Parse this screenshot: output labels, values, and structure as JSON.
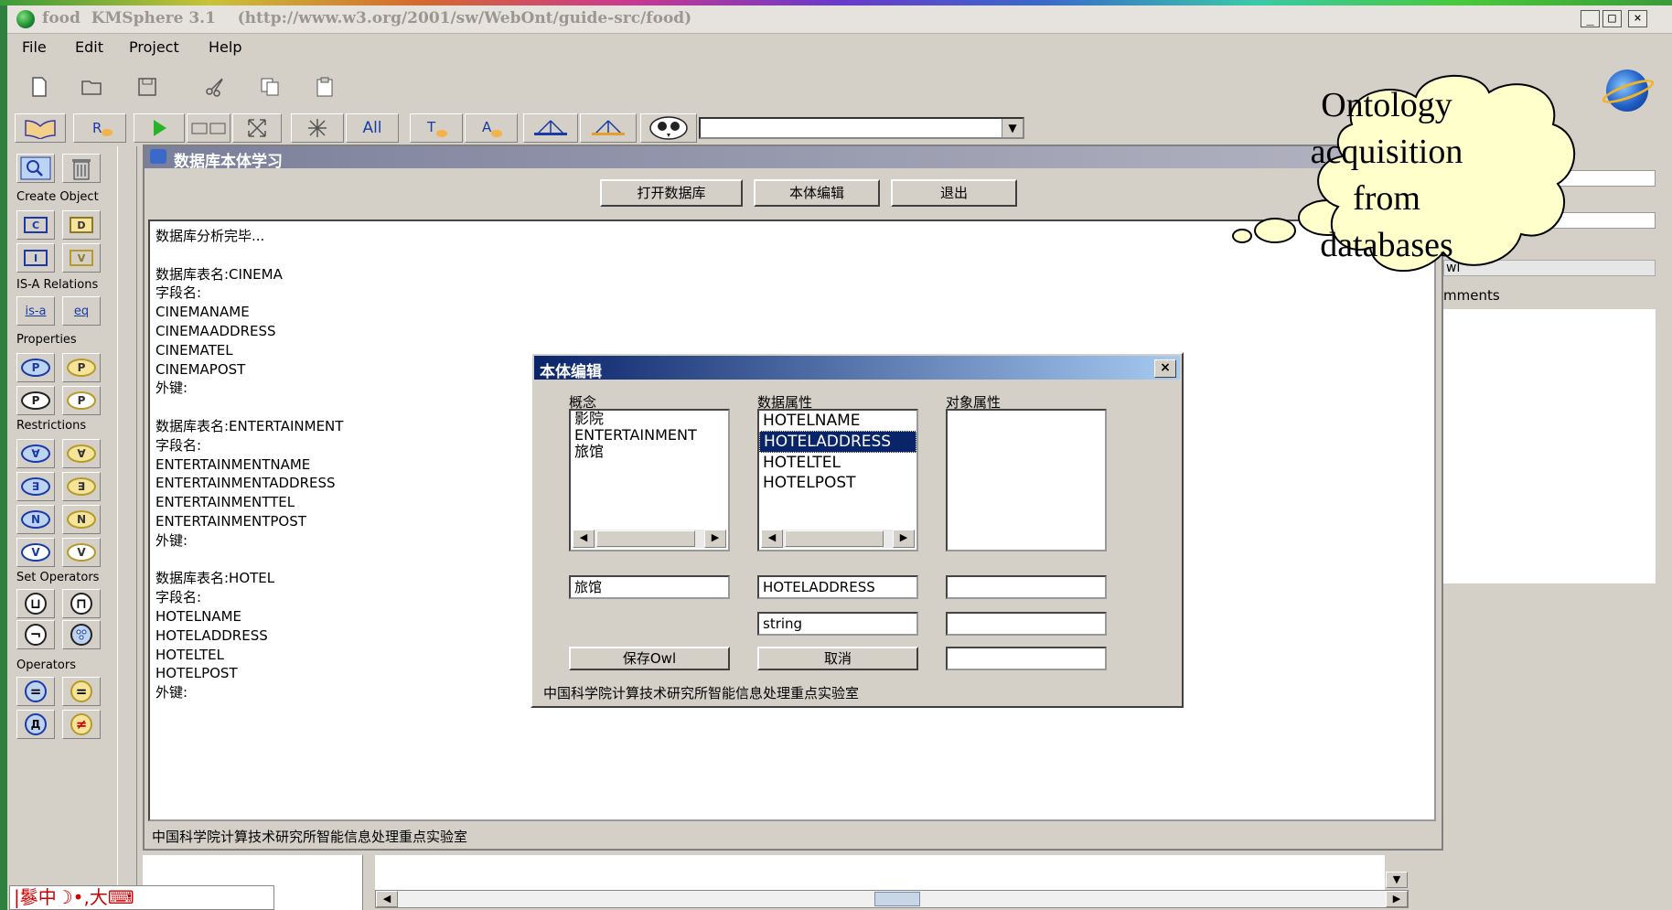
{
  "window": {
    "title": "food  KMSphere 3.1    (http://www.w3.org/2001/sw/WebOnt/guide-src/food)",
    "minimize": "_",
    "maximize": "□",
    "close": "×"
  },
  "menu": [
    "File",
    "Edit",
    "Project",
    "Help"
  ],
  "toolbar2": {
    "all_label": "All"
  },
  "palette": {
    "create_object": "Create Object",
    "btn_c": "C",
    "btn_d": "D",
    "btn_i": "I",
    "btn_v": "V",
    "isa_relations": "IS-A Relations",
    "is_a": "is-a",
    "eq": "eq",
    "properties": "Properties",
    "p1": "P",
    "p2": "P",
    "p3": "P",
    "p4": "P",
    "restrictions": "Restrictions",
    "r_forall": "∀",
    "r_forall_d": "∀",
    "r_exists": "∃",
    "r_exists_d": "∃",
    "r_n": "N",
    "r_nd": "N",
    "r_v": "V",
    "r_vd": "V",
    "set_operators": "Set Operators",
    "union": "⊔",
    "intersection": "⊓",
    "not": "¬",
    "operators": "Operators",
    "op_eq": "=",
    "op_eq2": "=",
    "op_neq": "≠"
  },
  "main_window": {
    "title": "数据库本体学习",
    "buttons": [
      "打开数据库",
      "本体编辑",
      "退出"
    ],
    "log": [
      "数据库分析完毕...",
      "",
      "数据库表名:CINEMA",
      "字段名:",
      "CINEMANAME",
      "CINEMAADDRESS",
      "CINEMATEL",
      "CINEMAPOST",
      "外键:",
      "",
      "数据库表名:ENTERTAINMENT",
      "字段名:",
      "ENTERTAINMENTNAME",
      "ENTERTAINMENTADDRESS",
      "ENTERTAINMENTTEL",
      "ENTERTAINMENTPOST",
      "外键:",
      "",
      "数据库表名:HOTEL",
      "字段名:",
      "HOTELNAME",
      "HOTELADDRESS",
      "HOTELTEL",
      "HOTELPOST",
      "外键:"
    ],
    "status": "中国科学院计算技术研究所智能信息处理重点实验室"
  },
  "right_panel": {
    "field1": "",
    "field2": "",
    "owl": "wl",
    "comments_label": "mments"
  },
  "dialog": {
    "title": "本体编辑",
    "close": "×",
    "concepts_label": "概念",
    "data_props_label": "数据属性",
    "object_props_label": "对象属性",
    "concepts": [
      "影院",
      "ENTERTAINMENT",
      "旅馆"
    ],
    "data_props": [
      "HOTELNAME",
      "HOTELADDRESS",
      "HOTELTEL",
      "HOTELPOST"
    ],
    "selected_data_prop": "HOTELADDRESS",
    "concept_field": "旅馆",
    "prop_field": "HOTELADDRESS",
    "type_field": "string",
    "object_field1": "",
    "object_field2": "",
    "object_field3": "",
    "save_button": "保存Owl",
    "cancel_button": "取消",
    "footer": "中国科学院计算技术研究所智能信息处理重点实验室"
  },
  "callout": {
    "lines": [
      "Ontology",
      "acquisition",
      "from",
      "databases"
    ]
  },
  "taskbar": {
    "ime": "|鬖中☽•,大⌨"
  },
  "icons": {
    "new": "new-file-icon",
    "open": "open-folder-icon",
    "save": "save-icon",
    "cut": "cut-icon",
    "copy": "copy-icon",
    "paste": "paste-icon"
  }
}
